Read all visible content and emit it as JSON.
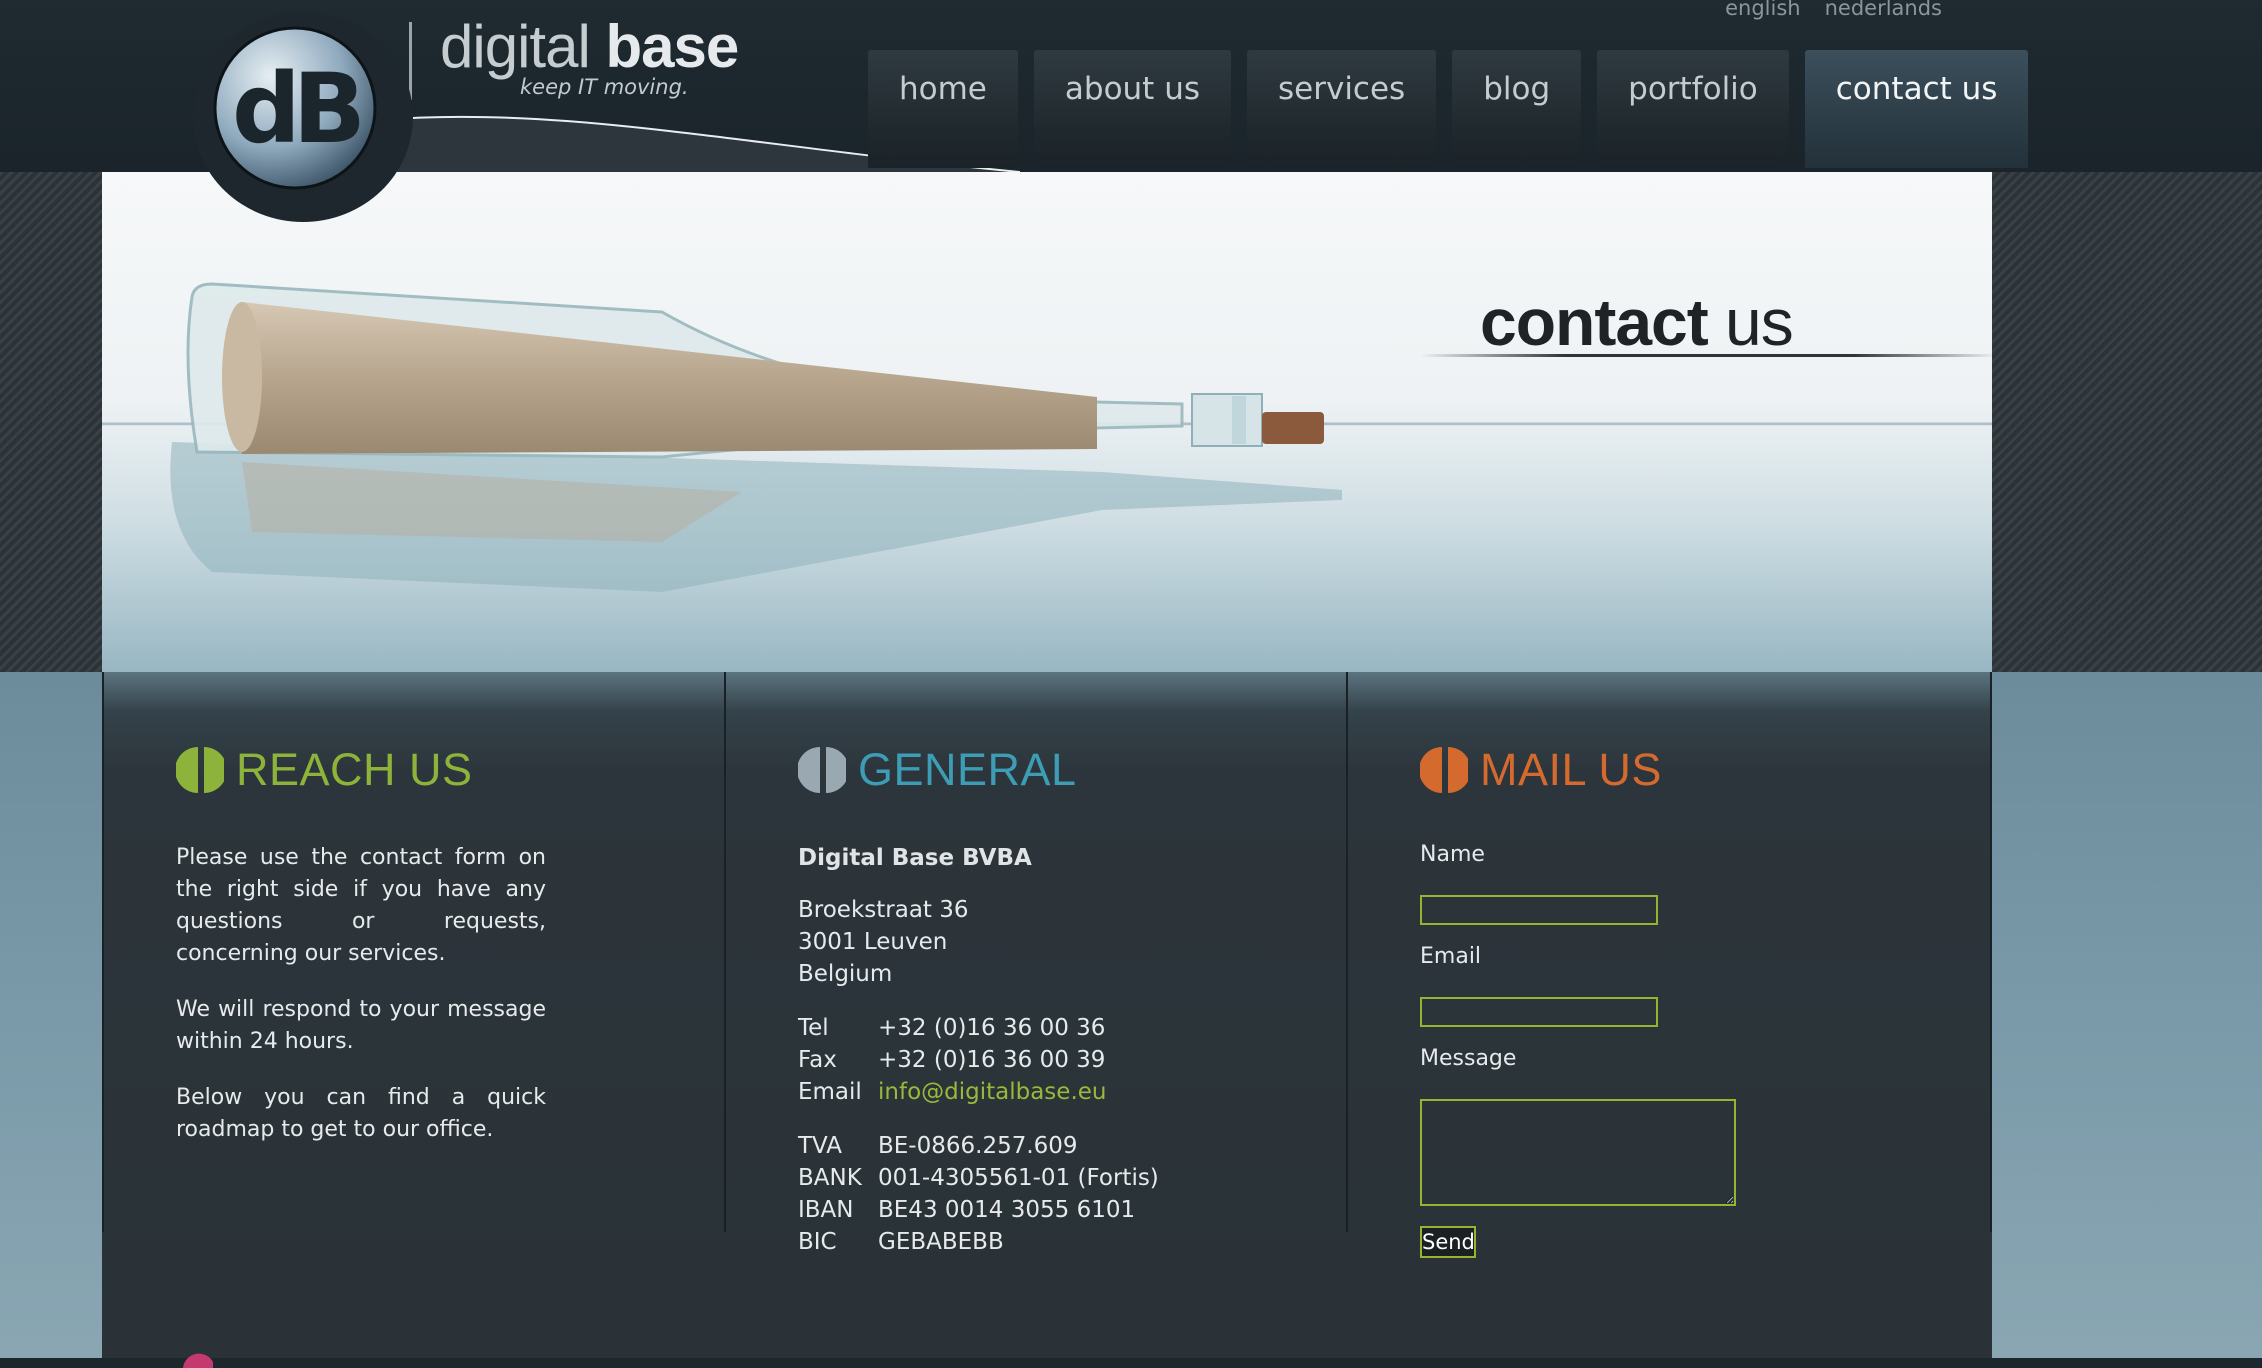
{
  "lang": {
    "english": "english",
    "nederlands": "nederlands"
  },
  "logo": {
    "name_light": "digital ",
    "name_bold": "base",
    "tagline": "keep IT moving.",
    "badge_text": "dB"
  },
  "nav": {
    "home": "home",
    "about": "about us",
    "services": "services",
    "blog": "blog",
    "portfolio": "portfolio",
    "contact": "contact us"
  },
  "banner": {
    "title_bold": "contact",
    "title_light": " us"
  },
  "reach": {
    "heading": "REACH US",
    "color": "#8db33a",
    "p1": "Please use the contact form on the right side if you have any questions or requests, concerning our services.",
    "p2": "We will respond to your message within 24 hours.",
    "p3": "Below you can find a quick roadmap to get to our office."
  },
  "general": {
    "heading": "GENERAL",
    "color": "#3c9db5",
    "company": "Digital Base BVBA",
    "street": "Broekstraat 36",
    "city": "3001 Leuven",
    "country": "Belgium",
    "tel_label": "Tel",
    "tel": "+32 (0)16 36 00 36",
    "fax_label": "Fax",
    "fax": "+32 (0)16 36 00 39",
    "email_label": "Email",
    "email": "info@digitalbase.eu",
    "tva_label": "TVA",
    "tva": "BE-0866.257.609",
    "bank_label": "BANK",
    "bank": "001-4305561-01 (Fortis)",
    "iban_label": "IBAN",
    "iban": "BE43 0014 3055 6101",
    "bic_label": "BIC",
    "bic": "GEBABEBB"
  },
  "mail": {
    "heading": "MAIL US",
    "color": "#d46a2e",
    "name_label": "Name",
    "name_value": "",
    "email_label": "Email",
    "email_value": "",
    "message_label": "Message",
    "message_value": "",
    "send_label": "Send"
  }
}
